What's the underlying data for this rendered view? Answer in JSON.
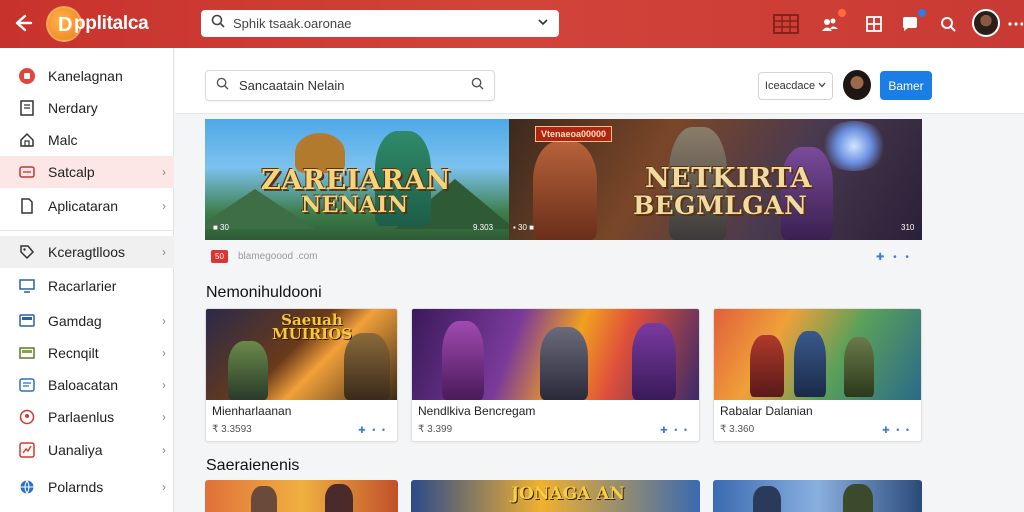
{
  "topbar": {
    "app_title": "pplitalca",
    "search_value": "Sphik tsaak.oaronae",
    "colors": {
      "bar": "#c8322c",
      "logo": "#f07d1e"
    },
    "icons": [
      "back-arrow-icon",
      "grid-table-icon",
      "people-icon",
      "apps-icon",
      "chat-icon",
      "search-icon",
      "more-icon"
    ]
  },
  "sidebar": {
    "items": [
      {
        "label": "Kanelagnan",
        "icon": "red-circle-icon"
      },
      {
        "label": "Nerdary",
        "icon": "page-icon"
      },
      {
        "label": "Malc",
        "icon": "home-icon"
      },
      {
        "label": "Satcalp",
        "icon": "card-icon",
        "chevron": "›"
      },
      {
        "label": "Aplicataran",
        "icon": "file-icon",
        "chevron": "›"
      },
      {
        "label": "Kceragtlloos",
        "icon": "tag-icon",
        "chevron": "›"
      },
      {
        "label": "Racarlarier",
        "icon": "monitor-icon"
      },
      {
        "label": "Gamdag",
        "icon": "screen-icon",
        "chevron": "›"
      },
      {
        "label": "Recnqilt",
        "icon": "box-icon",
        "chevron": "›"
      },
      {
        "label": "Baloacatan",
        "icon": "book-icon",
        "chevron": "›"
      },
      {
        "label": "Parlaenlus",
        "icon": "location-icon",
        "chevron": "›"
      },
      {
        "label": "Uanaliya",
        "icon": "chart-icon",
        "chevron": "›"
      },
      {
        "label": "Polarnds",
        "icon": "globe-icon",
        "chevron": "›"
      }
    ]
  },
  "main": {
    "search_value": "Sancaatain Nelain",
    "sort_label": "Iceacdace",
    "primary_button": "Bamer",
    "banner": {
      "left_title_1": "ZAREIARAN",
      "left_title_2": "NENAIN",
      "left_meta_a": "■ 30",
      "left_meta_b": "9.303",
      "right_tag": "Vtenaeoa00000",
      "right_title_1": "NETKIRTA",
      "right_title_2": "BEGMLGAN",
      "right_meta_a": "▪ 30 ■",
      "right_meta_b": "310"
    },
    "meta_badge": "50",
    "meta_text": "blamegoood .com",
    "share": "✚ • •",
    "section_1": "Nemonihuldooni",
    "section_2": "Saeraienenis",
    "cards": [
      {
        "name": "Mienharlaanan",
        "price": "₹ 3.3593",
        "thumb_title": "Saeuah MUIRIOS"
      },
      {
        "name": "Nendlkiva Bencregam",
        "price": "₹ 3.399",
        "thumb_title": ""
      },
      {
        "name": "Rabalar Dalanian",
        "price": "₹ 3.360",
        "thumb_title": ""
      }
    ],
    "card_actions": "✚ • •",
    "row2_title": "JONAGA AN"
  }
}
